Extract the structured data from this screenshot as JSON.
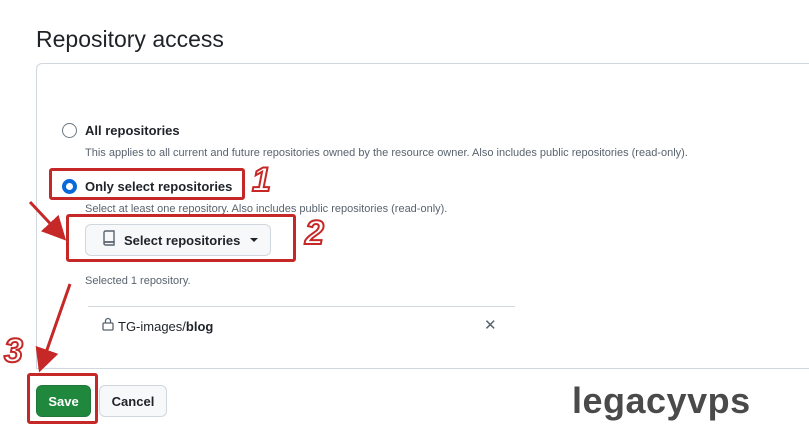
{
  "page": {
    "title": "Repository access"
  },
  "options": [
    {
      "label": "All repositories",
      "note": "This applies to all current and future repositories owned by the resource owner. Also includes public repositories (read-only).",
      "checked": false
    },
    {
      "label": "Only select repositories",
      "note": "Select at least one repository. Also includes public repositories (read-only).",
      "checked": true
    }
  ],
  "select_button": {
    "label": "Select repositories",
    "icon": "repo-icon"
  },
  "selection": {
    "summary": "Selected 1 repository.",
    "repos": [
      {
        "owner": "TG-images/",
        "name": "blog",
        "icon": "lock-icon",
        "remove_icon": "close-icon",
        "remove_glyph": "✕"
      }
    ]
  },
  "actions": {
    "save_label": "Save",
    "cancel_label": "Cancel"
  },
  "annotations": {
    "step1": "1",
    "step2": "2",
    "step3": "3",
    "color": "#c62828"
  },
  "watermark": "legacyvps"
}
